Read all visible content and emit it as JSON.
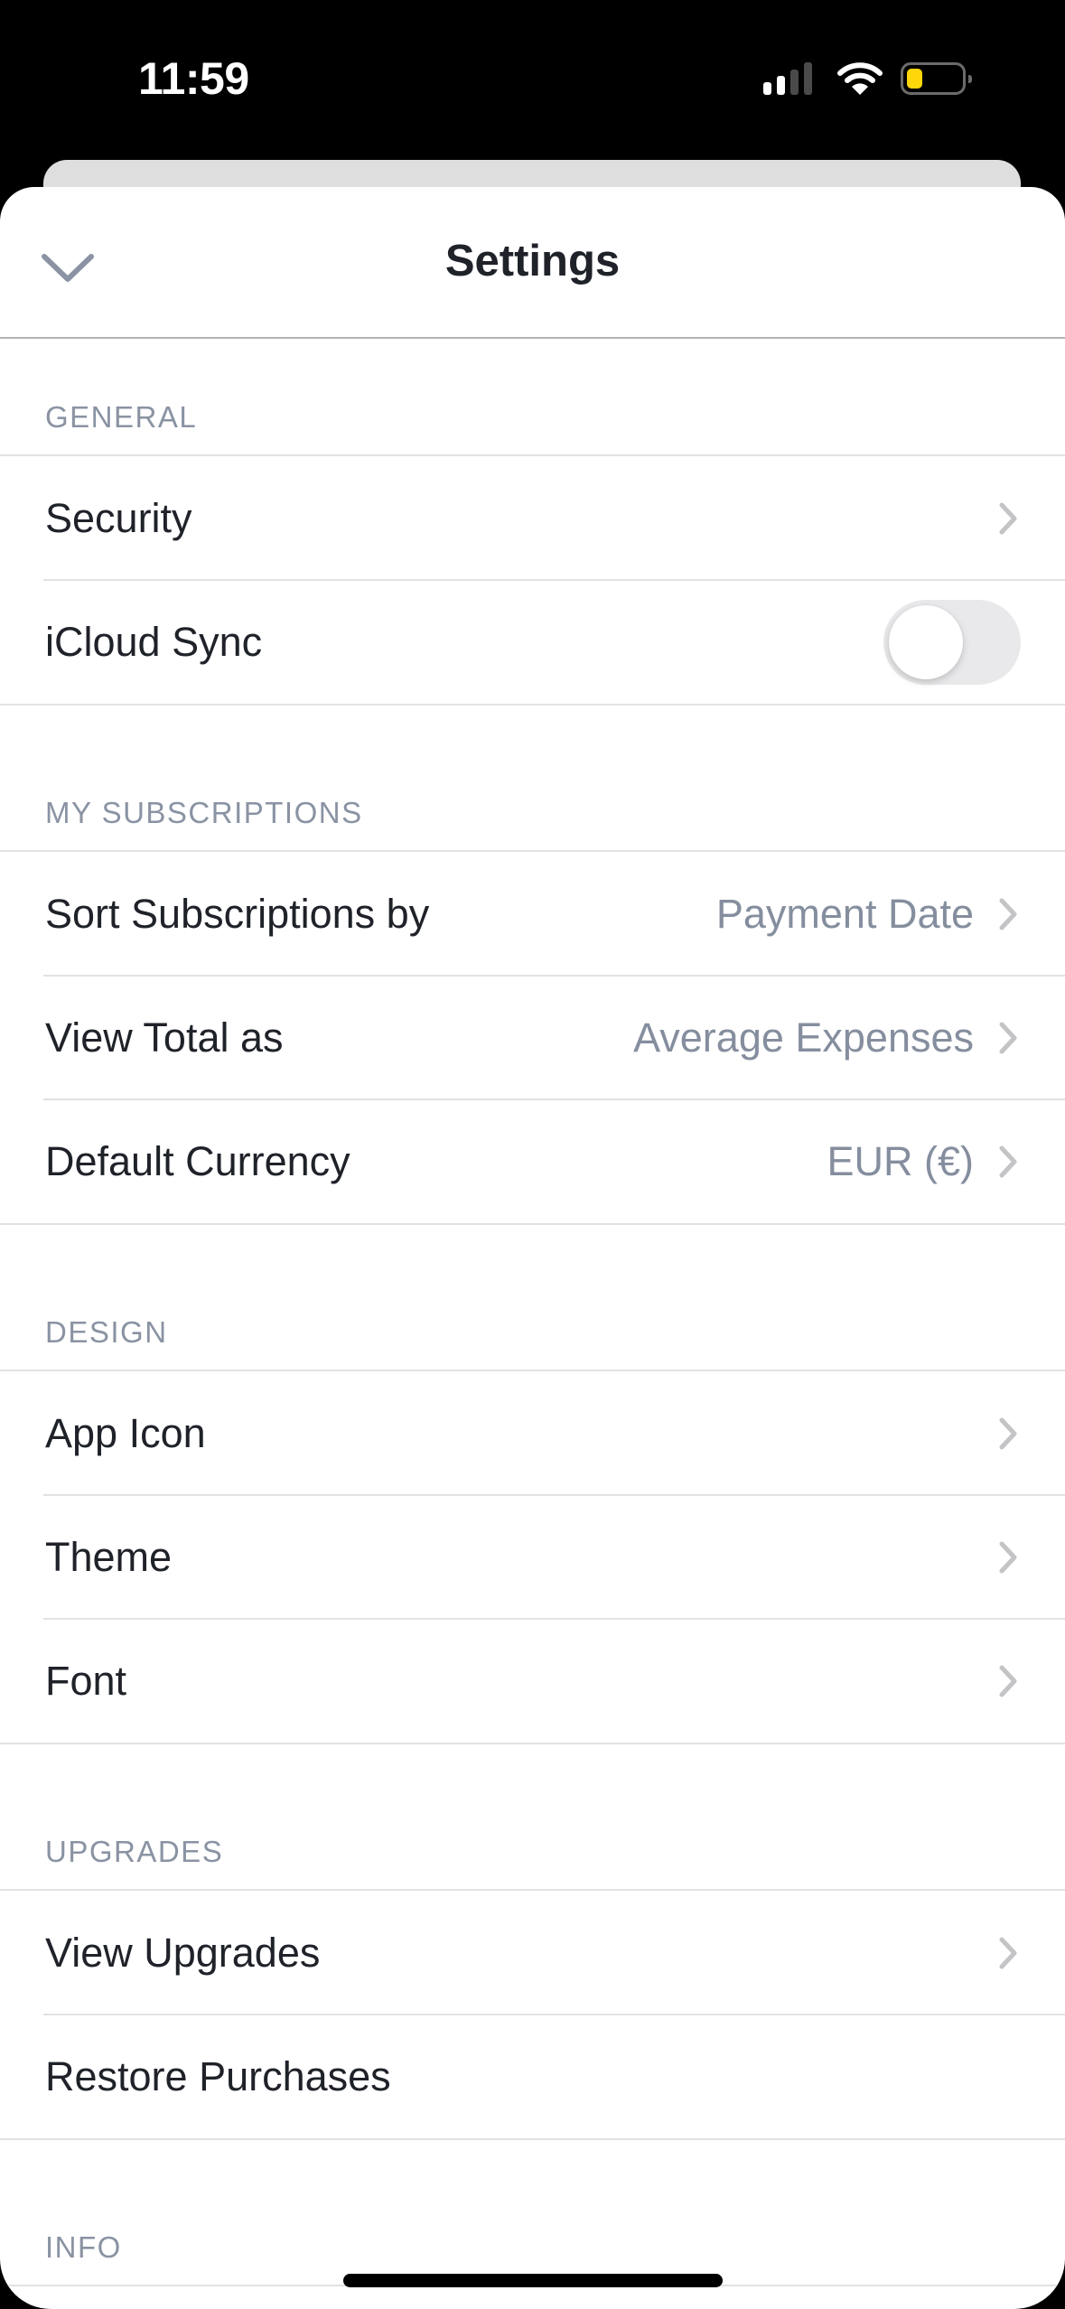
{
  "status_bar": {
    "time": "11:59",
    "signal_bars_active": 2,
    "signal_bars_total": 4,
    "wifi": "wifi-icon",
    "battery_level_percent": 30,
    "battery_color": "#ffd60a"
  },
  "header": {
    "title": "Settings",
    "close_icon": "chevron-down-icon"
  },
  "sections": [
    {
      "title": "GENERAL",
      "rows": [
        {
          "label": "Security",
          "value": "",
          "accessory": "chevron"
        },
        {
          "label": "iCloud Sync",
          "value": "",
          "accessory": "toggle",
          "toggle_on": false
        }
      ]
    },
    {
      "title": "MY SUBSCRIPTIONS",
      "rows": [
        {
          "label": "Sort Subscriptions by",
          "value": "Payment Date",
          "accessory": "chevron"
        },
        {
          "label": "View Total as",
          "value": "Average Expenses",
          "accessory": "chevron"
        },
        {
          "label": "Default Currency",
          "value": "EUR (€)",
          "accessory": "chevron"
        }
      ]
    },
    {
      "title": "DESIGN",
      "rows": [
        {
          "label": "App Icon",
          "value": "",
          "accessory": "chevron"
        },
        {
          "label": "Theme",
          "value": "",
          "accessory": "chevron"
        },
        {
          "label": "Font",
          "value": "",
          "accessory": "chevron"
        }
      ]
    },
    {
      "title": "UPGRADES",
      "rows": [
        {
          "label": "View Upgrades",
          "value": "",
          "accessory": "chevron"
        },
        {
          "label": "Restore Purchases",
          "value": "",
          "accessory": "none"
        }
      ]
    },
    {
      "title": "INFO",
      "rows": []
    }
  ],
  "colors": {
    "primary_text": "#1f2229",
    "secondary_text": "#858e9e",
    "section_label": "#8a93a3",
    "chevron": "#c4c4c6",
    "toggle_off": "#e9e9eb"
  }
}
